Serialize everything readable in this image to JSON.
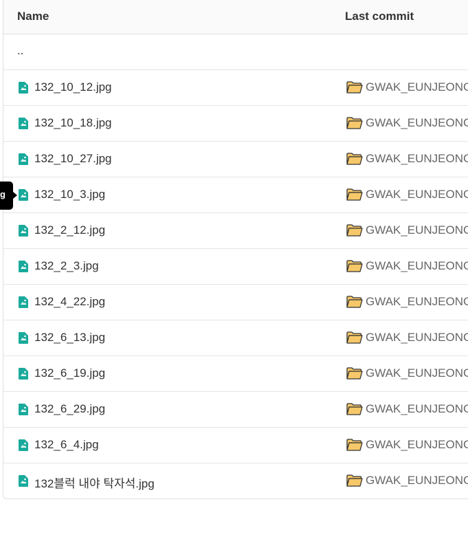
{
  "table": {
    "header": {
      "name": "Name",
      "last_commit": "Last commit"
    },
    "parent_dir": "..",
    "rows": [
      {
        "name": "132_10_12.jpg",
        "commit": "GWAK_EUNJEONG"
      },
      {
        "name": "132_10_18.jpg",
        "commit": "GWAK_EUNJEONG"
      },
      {
        "name": "132_10_27.jpg",
        "commit": "GWAK_EUNJEONG"
      },
      {
        "name": "132_10_3.jpg",
        "commit": "GWAK_EUNJEONG"
      },
      {
        "name": "132_2_12.jpg",
        "commit": "GWAK_EUNJEONG"
      },
      {
        "name": "132_2_3.jpg",
        "commit": "GWAK_EUNJEONG"
      },
      {
        "name": "132_4_22.jpg",
        "commit": "GWAK_EUNJEONG"
      },
      {
        "name": "132_6_13.jpg",
        "commit": "GWAK_EUNJEONG"
      },
      {
        "name": "132_6_19.jpg",
        "commit": "GWAK_EUNJEONG"
      },
      {
        "name": "132_6_29.jpg",
        "commit": "GWAK_EUNJEONG"
      },
      {
        "name": "132_6_4.jpg",
        "commit": "GWAK_EUNJEONG"
      },
      {
        "name": "132블럭 내야 탁자석.jpg",
        "commit": "GWAK_EUNJEONG"
      }
    ]
  },
  "tooltip": {
    "text": "g"
  },
  "icons": {
    "file": "image-file-icon",
    "commit": "folder-icon"
  },
  "colors": {
    "file_icon": "#1aaa9b",
    "folder_fill": "#f6c86a",
    "folder_stroke": "#333333"
  }
}
